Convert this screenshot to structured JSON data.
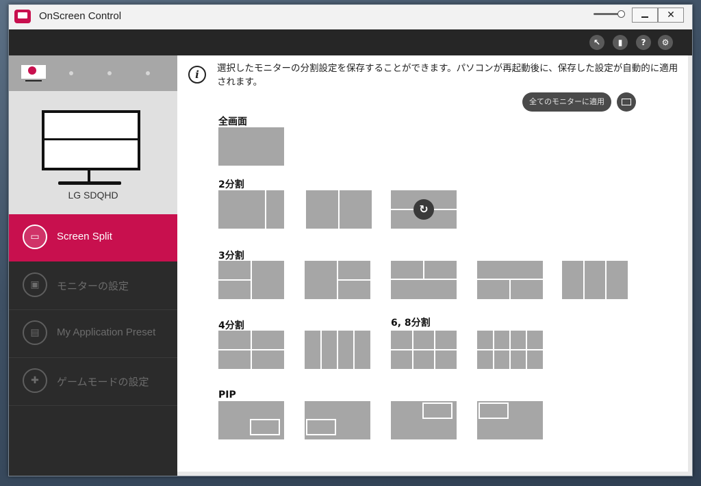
{
  "window": {
    "title": "OnScreen Control",
    "minimize_glyph": "",
    "close_glyph": "✕"
  },
  "toolbar": {
    "icons": [
      "cursor-icon",
      "display-icon",
      "help-icon",
      "gear-icon"
    ],
    "help_glyph": "?",
    "gear_glyph": "⚙",
    "cursor_glyph": "↖",
    "display_glyph": "▮"
  },
  "sidebar": {
    "monitor_name": "LG SDQHD",
    "nav": [
      {
        "label": "Screen Split",
        "icon": "screen-split-icon",
        "glyph": "▭",
        "active": true
      },
      {
        "label": "モニターの設定",
        "icon": "monitor-settings-icon",
        "glyph": "▣",
        "active": false
      },
      {
        "label": "My Application Preset",
        "icon": "app-preset-icon",
        "glyph": "▤",
        "active": false
      },
      {
        "label": "ゲームモードの設定",
        "icon": "gamepad-icon",
        "glyph": "✚",
        "active": false
      }
    ]
  },
  "content": {
    "info_glyph": "i",
    "info_text": "選択したモニターの分割設定を保存することができます。パソコンが再起動後に、保存した設定が自動的に適用されます。",
    "apply_all_label": "全てのモニターに適用",
    "sections": {
      "full": "全画面",
      "two": "2分割",
      "three": "3分割",
      "four": "4分割",
      "six_eight": "6, 8分割",
      "pip": "PIP"
    },
    "rotate_glyph": "↻"
  },
  "colors": {
    "accent": "#c8104e",
    "sidebar_bg": "#2b2b2b",
    "tile": "#a6a6a6",
    "toolbar_bg": "#262626"
  }
}
